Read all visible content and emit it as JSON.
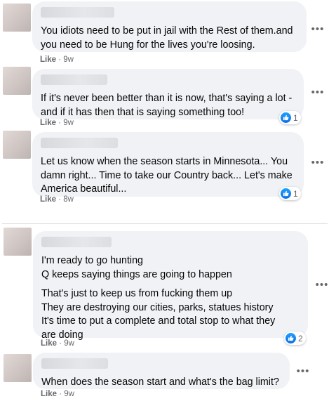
{
  "comments": [
    {
      "text": "You idiots need to be put in jail with the Rest of them.and\nyou need to be Hung for the lives you're loosing.",
      "like_label": "Like",
      "separator": "·",
      "time": "9w"
    },
    {
      "text": "If it's never been better than it is now, that's saying a lot -\nand if it has then that is saying something too!",
      "like_label": "Like",
      "separator": "·",
      "time": "9w",
      "reactions": "1"
    },
    {
      "text": "Let us know when the season starts in Minnesota... You\ndamn right... Time to take our Country back... Let's make\nAmerica beautiful...",
      "like_label": "Like",
      "separator": "·",
      "time": "8w",
      "reactions": "1"
    },
    {
      "text": "I'm ready to go hunting\nQ keeps saying things are going to happen",
      "text2": "That's just to keep us from fucking them up\nThey are destroying our cities, parks, statues history\nIt's time to put a complete and total stop to what they\nare doing",
      "like_label": "Like",
      "separator": "·",
      "time": "9w",
      "reactions": "2"
    },
    {
      "text": "When does the season start and what's the bag limit?",
      "like_label": "Like",
      "separator": "·",
      "time": "9w"
    }
  ],
  "more_options_glyph": "•••",
  "icons": {
    "reaction": "thumbs-up-icon",
    "more": "more-options-icon"
  },
  "colors": {
    "bubble": "#f0f2f5",
    "meta": "#65676b",
    "like_icon": "#1877f2"
  }
}
